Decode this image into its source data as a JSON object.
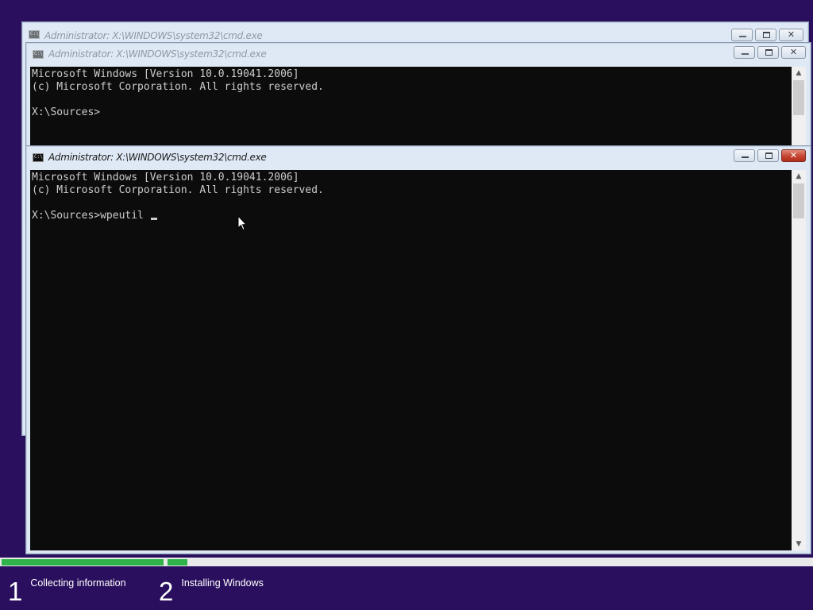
{
  "windows": [
    {
      "title": "Administrator: X:\\WINDOWS\\system32\\cmd.exe",
      "state": "inactive"
    },
    {
      "title": "Administrator: X:\\WINDOWS\\system32\\cmd.exe",
      "state": "inactive",
      "console": [
        "Microsoft Windows [Version 10.0.19041.2006]",
        "(c) Microsoft Corporation. All rights reserved.",
        "",
        "X:\\Sources>"
      ]
    },
    {
      "title": "Administrator: X:\\WINDOWS\\system32\\cmd.exe",
      "state": "active",
      "console": [
        "Microsoft Windows [Version 10.0.19041.2006]",
        "(c) Microsoft Corporation. All rights reserved.",
        "",
        "X:\\Sources>wpeutil "
      ]
    }
  ],
  "setup": {
    "steps": [
      {
        "number": "1",
        "label": "Collecting information"
      },
      {
        "number": "2",
        "label": "Installing Windows"
      }
    ]
  },
  "icons": [
    "cmd-icon",
    "minimize-icon",
    "maximize-icon",
    "close-icon",
    "scroll-up-icon",
    "scroll-down-icon",
    "mouse-pointer-icon"
  ],
  "colors": {
    "desktop_bg": "#2a0f5e",
    "console_bg": "#0c0c0c",
    "console_fg": "#cccccc",
    "progress_fill": "#2fb34a",
    "close_active": "#c44330"
  }
}
